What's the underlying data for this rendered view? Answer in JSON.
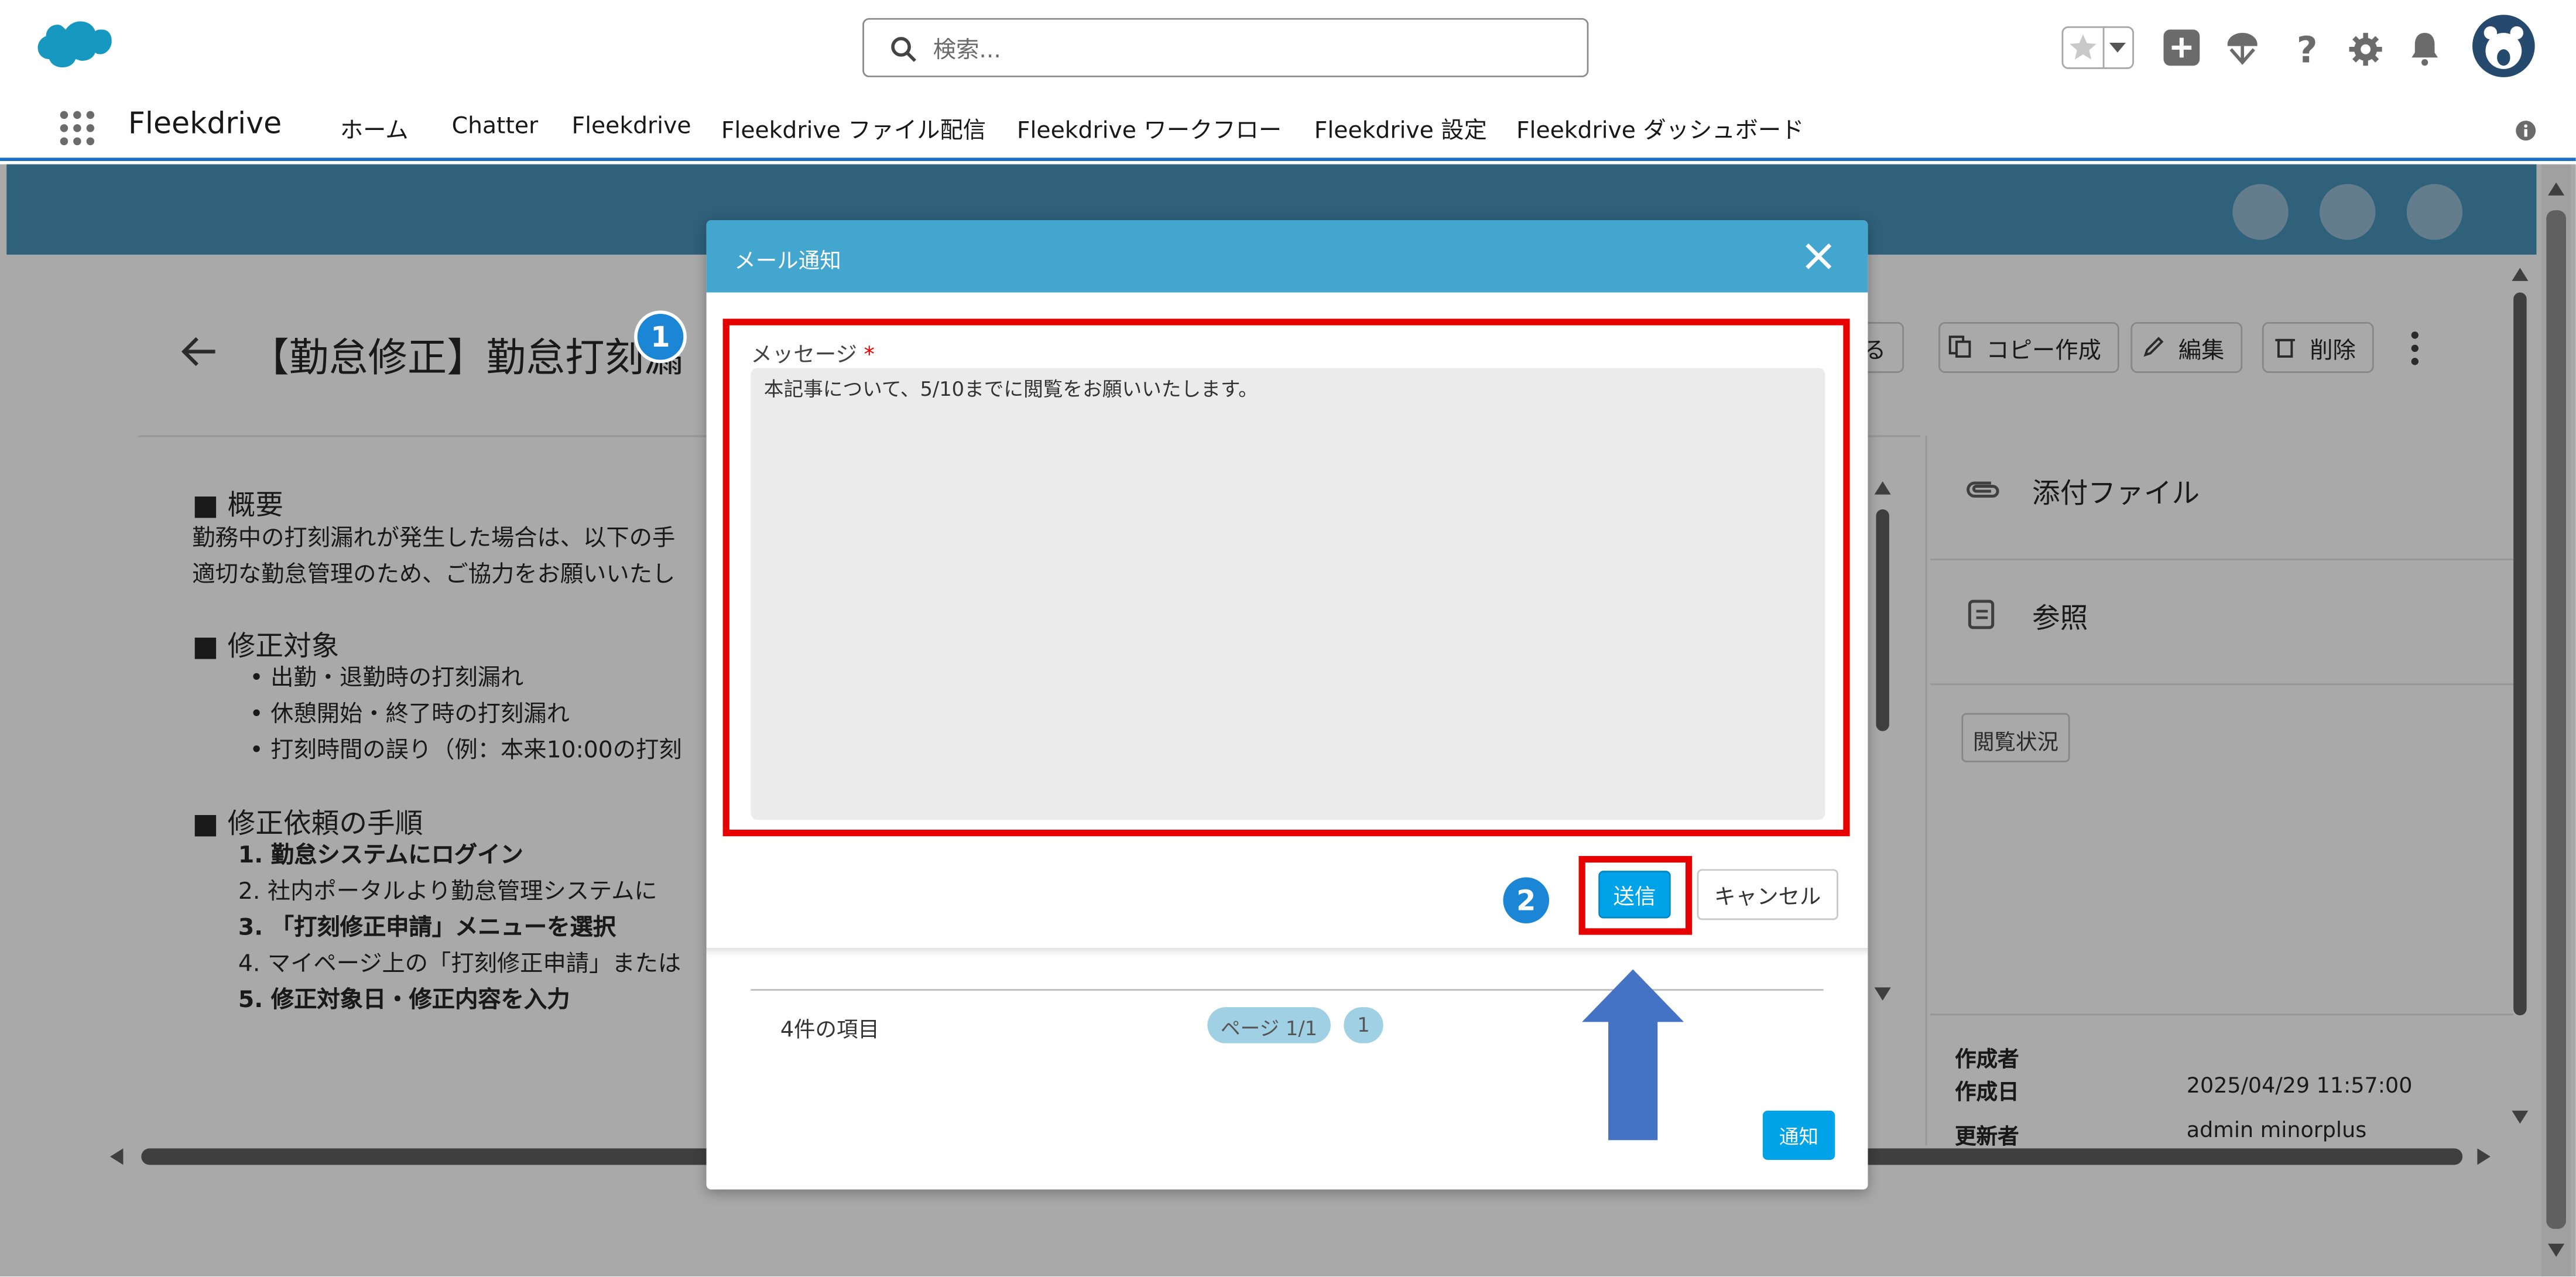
{
  "header": {
    "search_placeholder": "検索..."
  },
  "nav": {
    "app_name": "Fleekdrive",
    "items": [
      "ホーム",
      "Chatter",
      "Fleekdrive",
      "Fleekdrive ファイル配信",
      "Fleekdrive ワークフロー",
      "Fleekdrive 設定",
      "Fleekdrive ダッシュボード"
    ]
  },
  "record": {
    "title": "【勤怠修正】勤怠打刻漏",
    "actions": [
      "する",
      "コピー作成",
      "編集",
      "削除"
    ],
    "sections": [
      {
        "heading": "■ 概要",
        "lines": [
          "勤務中の打刻漏れが発生した場合は、以下の手",
          "適切な勤怠管理のため、ご協力をお願いいたし"
        ]
      },
      {
        "heading": "■ 修正対象",
        "lines": [
          "• 出勤・退勤時の打刻漏れ",
          "• 休憩開始・終了時の打刻漏れ",
          "• 打刻時間の誤り（例：本来10:00の打刻"
        ]
      },
      {
        "heading": "■ 修正依頼の手順",
        "lines": [
          "1. 勤怠システムにログイン",
          "2. 社内ポータルより勤怠管理システムに",
          "3. 「打刻修正申請」メニューを選択",
          "4. マイページ上の「打刻修正申請」または",
          "5. 修正対象日・修正内容を入力"
        ]
      }
    ],
    "side": {
      "attachments": "添付ファイル",
      "references": "参照",
      "read_status_button": "閲覧状況",
      "created_by_label": "作成者",
      "created_date_label": "作成日",
      "created_date_value": "2025/04/29 11:57:00",
      "updated_by_label": "更新者",
      "updated_by_value": "admin minorplus"
    }
  },
  "modal": {
    "title": "メール通知",
    "message_label": "メッセージ",
    "required_mark": "*",
    "message_value": "本記事について、5/10までに閲覧をお願いいたします。",
    "send_label": "送信",
    "cancel_label": "キャンセル",
    "item_count": "4件の項目",
    "pager_label": "ページ 1/1",
    "page_number": "1",
    "notify_label": "通知"
  },
  "annotations": {
    "step1": "1",
    "step2": "2",
    "highlight_color": "#e60000",
    "badge_color": "#1b86d6",
    "arrow_color": "#4472c4"
  }
}
